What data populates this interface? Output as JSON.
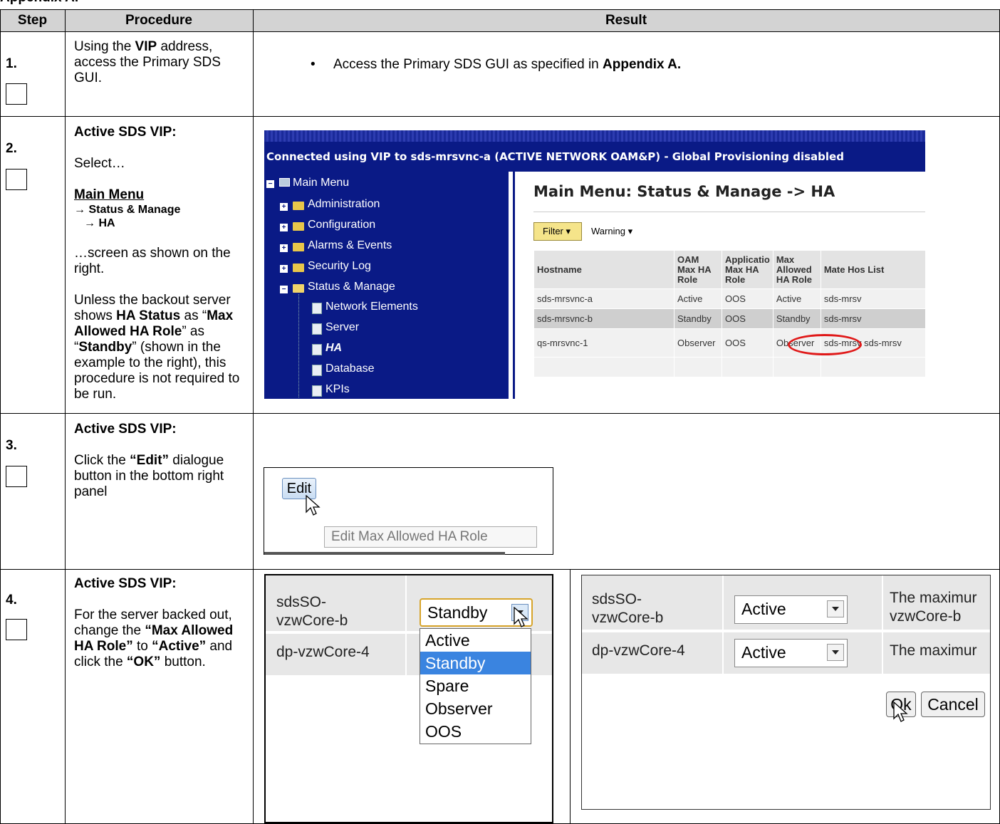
{
  "header": {
    "step": "Step",
    "procedure": "Procedure",
    "result": "Result"
  },
  "steps": [
    {
      "num": "1.",
      "procedure_parts": [
        "Using the ",
        "VIP",
        " address, access the Primary SDS GUI."
      ],
      "result_parts": [
        "Access the Primary SDS GUI as specified in ",
        "Appendix A."
      ]
    },
    {
      "num": "2.",
      "heading": "Active SDS VIP:",
      "select": "Select…",
      "menu": "Main Menu",
      "path1": "→ Status & Manage",
      "path2": "→ HA",
      "screen_note": "…screen as shown on the right.",
      "unless_parts": [
        "Unless the backout server shows ",
        "HA Status",
        " as “",
        "Max Allowed HA Role",
        "” as “",
        "Standby",
        "” (shown in the example to the right), this procedure is not required to be run."
      ]
    },
    {
      "num": "3.",
      "heading": "Active SDS VIP:",
      "body_parts": [
        "Click the ",
        "“Edit”",
        " dialogue button in the bottom right panel"
      ]
    },
    {
      "num": "4.",
      "heading": "Active SDS VIP:",
      "body_parts": [
        "For the server backed out, change the ",
        "“Max Allowed HA Role”",
        " to ",
        "“Active”",
        " and click the ",
        "“OK”",
        " button."
      ]
    }
  ],
  "screenshot_ha": {
    "connected": "Connected using VIP to sds-mrsvnc-a (ACTIVE NETWORK OAM&P) - Global Provisioning disabled",
    "nav": [
      "Main Menu",
      "Administration",
      "Configuration",
      "Alarms & Events",
      "Security Log",
      "Status & Manage",
      "Network Elements",
      "Server",
      "HA",
      "Database",
      "KPIs"
    ],
    "title": "Main Menu: Status & Manage -> HA",
    "filter": "Filter",
    "warning": "Warning",
    "columns": [
      "Hostname",
      "OAM Max HA Role",
      "Applicatio Max HA Role",
      "Max Allowed HA Role",
      "Mate Hos List"
    ],
    "rows": [
      [
        "sds-mrsvnc-a",
        "Active",
        "OOS",
        "Active",
        "sds-mrsv"
      ],
      [
        "sds-mrsvnc-b",
        "Standby",
        "OOS",
        "Standby",
        "sds-mrsv"
      ],
      [
        "qs-mrsvnc-1",
        "Observer",
        "OOS",
        "Observer",
        "sds-mrsv sds-mrsv"
      ],
      [
        "",
        "",
        "",
        "",
        ""
      ]
    ]
  },
  "screenshot_edit": {
    "button": "Edit",
    "tooltip": "Edit Max Allowed HA Role"
  },
  "screenshot_dropdown": {
    "server1": "sdsSO-vzwCore-b",
    "server1_line1": "sdsSO-",
    "server1_line2": "vzwCore-b",
    "server2": "dp-vzwCore-4",
    "selected": "Standby",
    "options": [
      "Active",
      "Standby",
      "Spare",
      "Observer",
      "OOS"
    ]
  },
  "screenshot_ok": {
    "server1_line1": "sdsSO-",
    "server1_line2": "vzwCore-b",
    "server2": "dp-vzwCore-4",
    "value1": "Active",
    "value2": "Active",
    "desc1_line1": "The maximur",
    "desc1_line2": "vzwCore-b",
    "desc2": "The maximur",
    "ok": "Ok",
    "cancel": "Cancel"
  }
}
